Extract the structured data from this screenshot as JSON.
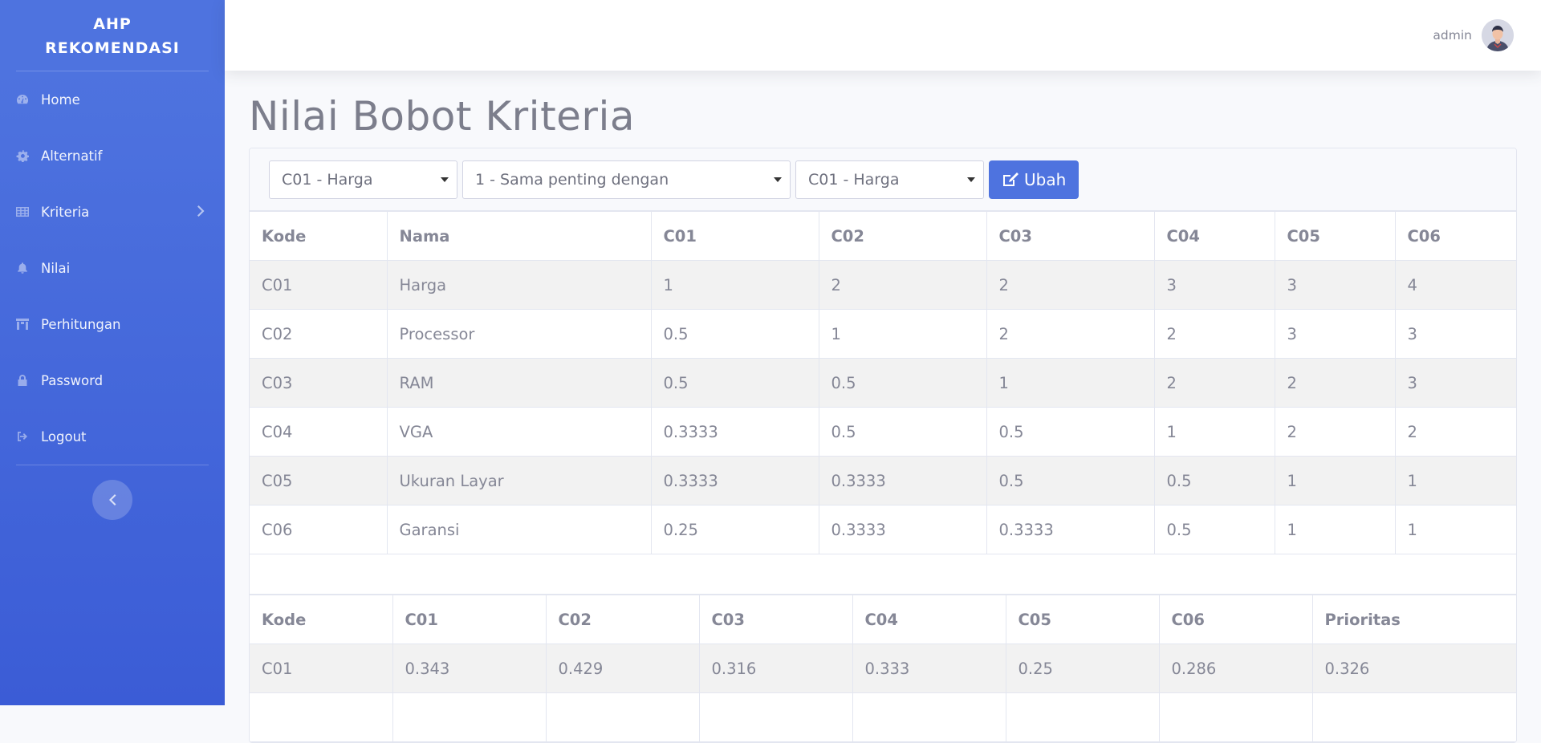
{
  "brand": {
    "line1": "AHP",
    "line2": "REKOMENDASI"
  },
  "sidebar": {
    "items": [
      {
        "label": "Home",
        "icon": "dashboard-icon"
      },
      {
        "label": "Alternatif",
        "icon": "cog-icon"
      },
      {
        "label": "Kriteria",
        "icon": "table-icon"
      },
      {
        "label": "Nilai",
        "icon": "bell-icon"
      },
      {
        "label": "Perhitungan",
        "icon": "building-icon"
      },
      {
        "label": "Password",
        "icon": "lock-icon"
      },
      {
        "label": "Logout",
        "icon": "sign-out-icon"
      }
    ]
  },
  "topbar": {
    "user": "admin"
  },
  "page": {
    "title": "Nilai Bobot Kriteria"
  },
  "form": {
    "criteria1": "C01 - Harga",
    "scale": "1 - Sama penting dengan",
    "criteria2": "C01 - Harga",
    "submit": "Ubah"
  },
  "matrix": {
    "headers": [
      "Kode",
      "Nama",
      "C01",
      "C02",
      "C03",
      "C04",
      "C05",
      "C06"
    ],
    "rows": [
      [
        "C01",
        "Harga",
        "1",
        "2",
        "2",
        "3",
        "3",
        "4"
      ],
      [
        "C02",
        "Processor",
        "0.5",
        "1",
        "2",
        "2",
        "3",
        "3"
      ],
      [
        "C03",
        "RAM",
        "0.5",
        "0.5",
        "1",
        "2",
        "2",
        "3"
      ],
      [
        "C04",
        "VGA",
        "0.3333",
        "0.5",
        "0.5",
        "1",
        "2",
        "2"
      ],
      [
        "C05",
        "Ukuran Layar",
        "0.3333",
        "0.3333",
        "0.5",
        "0.5",
        "1",
        "1"
      ],
      [
        "C06",
        "Garansi",
        "0.25",
        "0.3333",
        "0.3333",
        "0.5",
        "1",
        "1"
      ]
    ]
  },
  "priority": {
    "headers": [
      "Kode",
      "C01",
      "C02",
      "C03",
      "C04",
      "C05",
      "C06",
      "Prioritas"
    ],
    "rows": [
      [
        "C01",
        "0.343",
        "0.429",
        "0.316",
        "0.333",
        "0.25",
        "0.286",
        "0.326"
      ]
    ]
  },
  "colors": {
    "primary": "#4e73df",
    "sidebar_bottom": "#3b5cd6"
  }
}
